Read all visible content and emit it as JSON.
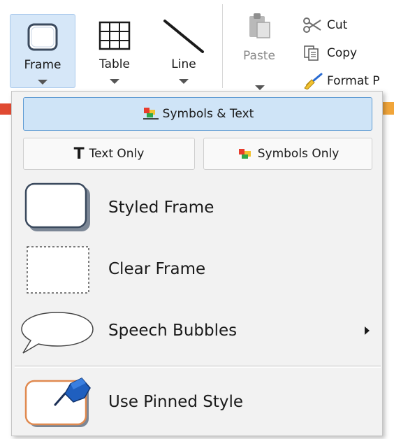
{
  "ribbon": {
    "frame_label": "Frame",
    "table_label": "Table",
    "line_label": "Line",
    "paste_label": "Paste",
    "cut_label": "Cut",
    "copy_label": "Copy",
    "format_painter_label": "Format P"
  },
  "menu": {
    "symbols_text_label": "Symbols & Text",
    "text_only_label": "Text Only",
    "symbols_only_label": "Symbols Only",
    "styled_frame_label": "Styled Frame",
    "clear_frame_label": "Clear Frame",
    "speech_bubbles_label": "Speech Bubbles",
    "use_pinned_style_label": "Use Pinned Style",
    "text_only_glyph": "T"
  },
  "colors": {
    "selected_fill": "#cfe4f7",
    "selected_border": "#5e9bd3",
    "frame_button_active": "#d6e7f8",
    "pin_blue": "#1f5fbf",
    "pinned_frame_border": "#e08a50"
  },
  "icons": {
    "frame": "rounded-frame-icon",
    "table": "table-grid-icon",
    "line": "diagonal-line-icon",
    "paste": "clipboard-icon",
    "cut": "scissors-icon",
    "copy": "copy-icon",
    "format_painter": "paintbrush-icon",
    "symbols": "symbol-pictures-icon",
    "pin": "pushpin-icon",
    "submenu": "triangle-right-icon"
  }
}
